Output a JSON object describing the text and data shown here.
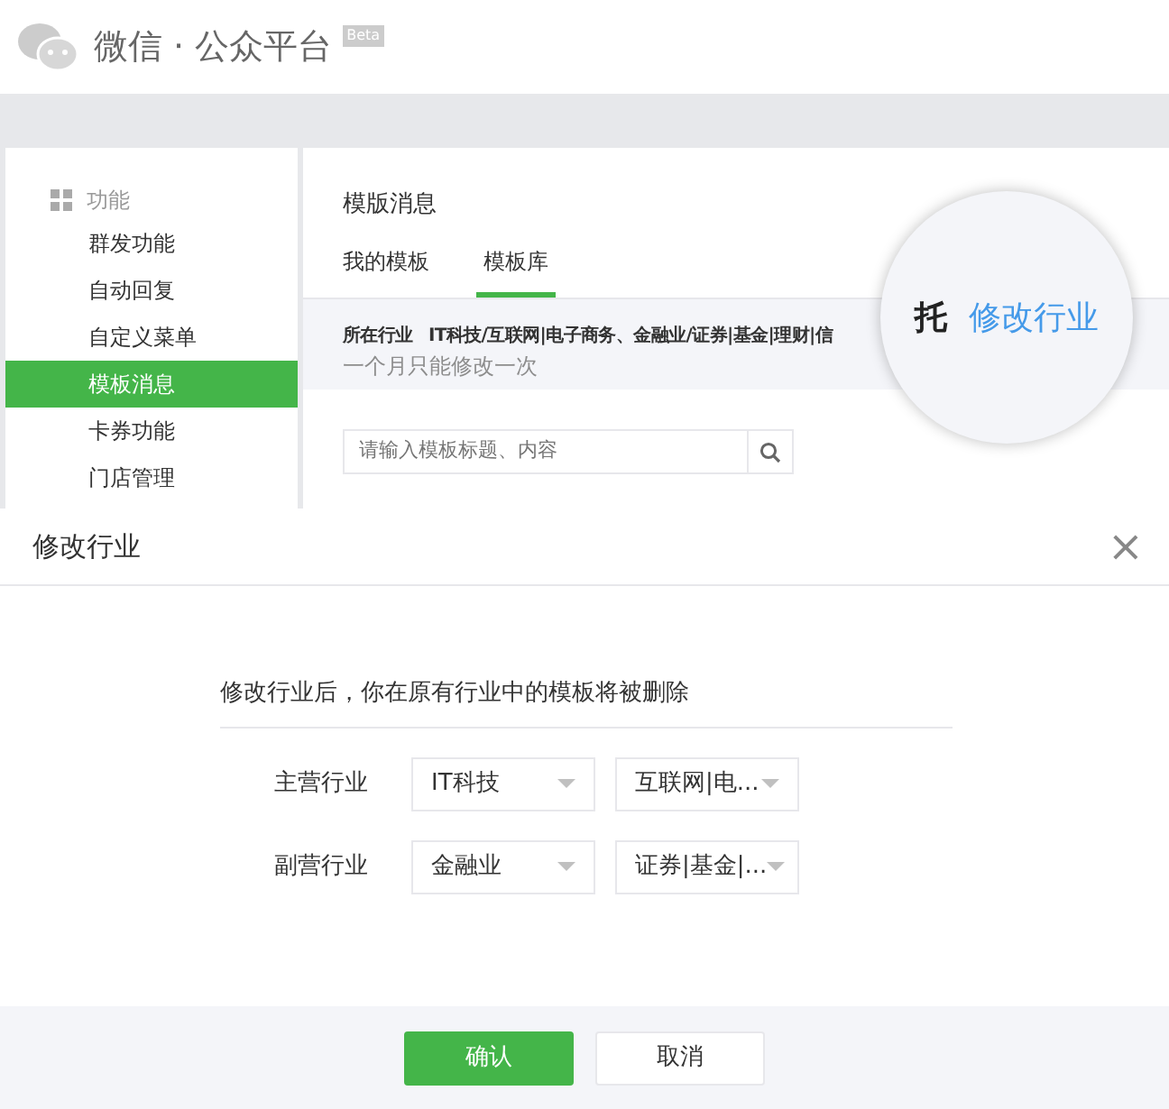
{
  "header": {
    "logo_text": "微信 · 公众平台",
    "badge": "Beta"
  },
  "sidebar": {
    "section": "功能",
    "items": [
      {
        "label": "群发功能",
        "selected": false
      },
      {
        "label": "自动回复",
        "selected": false
      },
      {
        "label": "自定义菜单",
        "selected": false
      },
      {
        "label": "模板消息",
        "selected": true
      },
      {
        "label": "卡券功能",
        "selected": false
      },
      {
        "label": "门店管理",
        "selected": false
      }
    ]
  },
  "content": {
    "title": "模版消息",
    "tabs": [
      {
        "label": "我的模板",
        "selected": false
      },
      {
        "label": "模板库",
        "selected": true
      }
    ],
    "industry_label": "所在行业",
    "industry_value": "IT科技/互联网|电子商务、金融业/证券|基金|理财|信",
    "note": "一个月只能修改一次",
    "magnifier": {
      "char": "托",
      "link": "修改行业"
    },
    "search": {
      "placeholder": "请输入模板标题、内容"
    }
  },
  "dialog": {
    "title": "修改行业",
    "close": "×",
    "warning": "修改行业后，你在原有行业中的模板将被删除",
    "rows": [
      {
        "label": "主营行业",
        "selects": [
          "IT科技",
          "互联网|电..."
        ]
      },
      {
        "label": "副营行业",
        "selects": [
          "金融业",
          "证券|基金|..."
        ]
      }
    ],
    "buttons": [
      {
        "label": "确认",
        "kind": "primary"
      },
      {
        "label": "取消",
        "kind": "default"
      }
    ]
  }
}
